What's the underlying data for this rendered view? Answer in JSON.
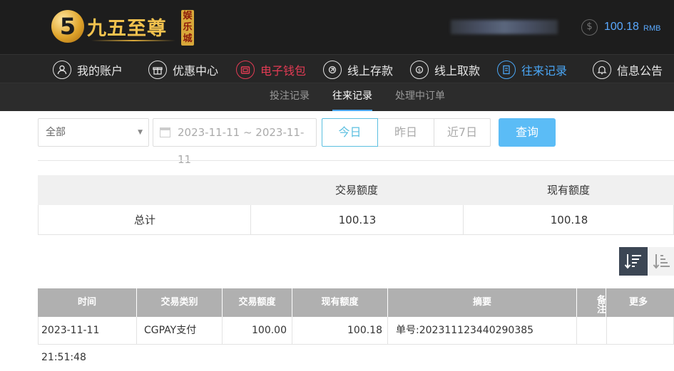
{
  "logo": {
    "numeral": "5",
    "name": "九五至尊",
    "tag": "娱乐城"
  },
  "balance": {
    "icon": "dollar-circle-icon",
    "amount": "100.18",
    "unit": "RMB"
  },
  "nav": [
    {
      "label": "我的账户",
      "icon": "user-icon"
    },
    {
      "label": "优惠中心",
      "icon": "gift-icon"
    },
    {
      "label": "电子钱包",
      "icon": "wallet-icon"
    },
    {
      "label": "线上存款",
      "icon": "deposit-icon"
    },
    {
      "label": "线上取款",
      "icon": "withdraw-icon"
    },
    {
      "label": "往来记录",
      "icon": "records-icon"
    },
    {
      "label": "信息公告",
      "icon": "bell-icon"
    }
  ],
  "subnav": [
    "投注记录",
    "往来记录",
    "处理中订单"
  ],
  "filter": {
    "type_value": "全部",
    "date_range": "2023-11-11 ~ 2023-11-11",
    "quick": [
      "今日",
      "昨日",
      "近7日"
    ],
    "query_label": "查询"
  },
  "summary": {
    "headers": [
      "",
      "交易额度",
      "现有额度"
    ],
    "row": [
      "总计",
      "100.13",
      "100.18"
    ]
  },
  "table": {
    "headers": [
      "时间",
      "交易类别",
      "交易额度",
      "现有额度",
      "摘要",
      "备注",
      "更多"
    ],
    "rows": [
      [
        "2023-11-11 21:51:48",
        "CGPAY支付",
        "100.00",
        "100.18",
        "单号:202311123440290385",
        "",
        ""
      ]
    ]
  },
  "colors": {
    "accent_blue": "#4aa6f5",
    "accent_red": "#e23b54",
    "gold": "#f2c24e",
    "query_button": "#5bbcf6"
  }
}
